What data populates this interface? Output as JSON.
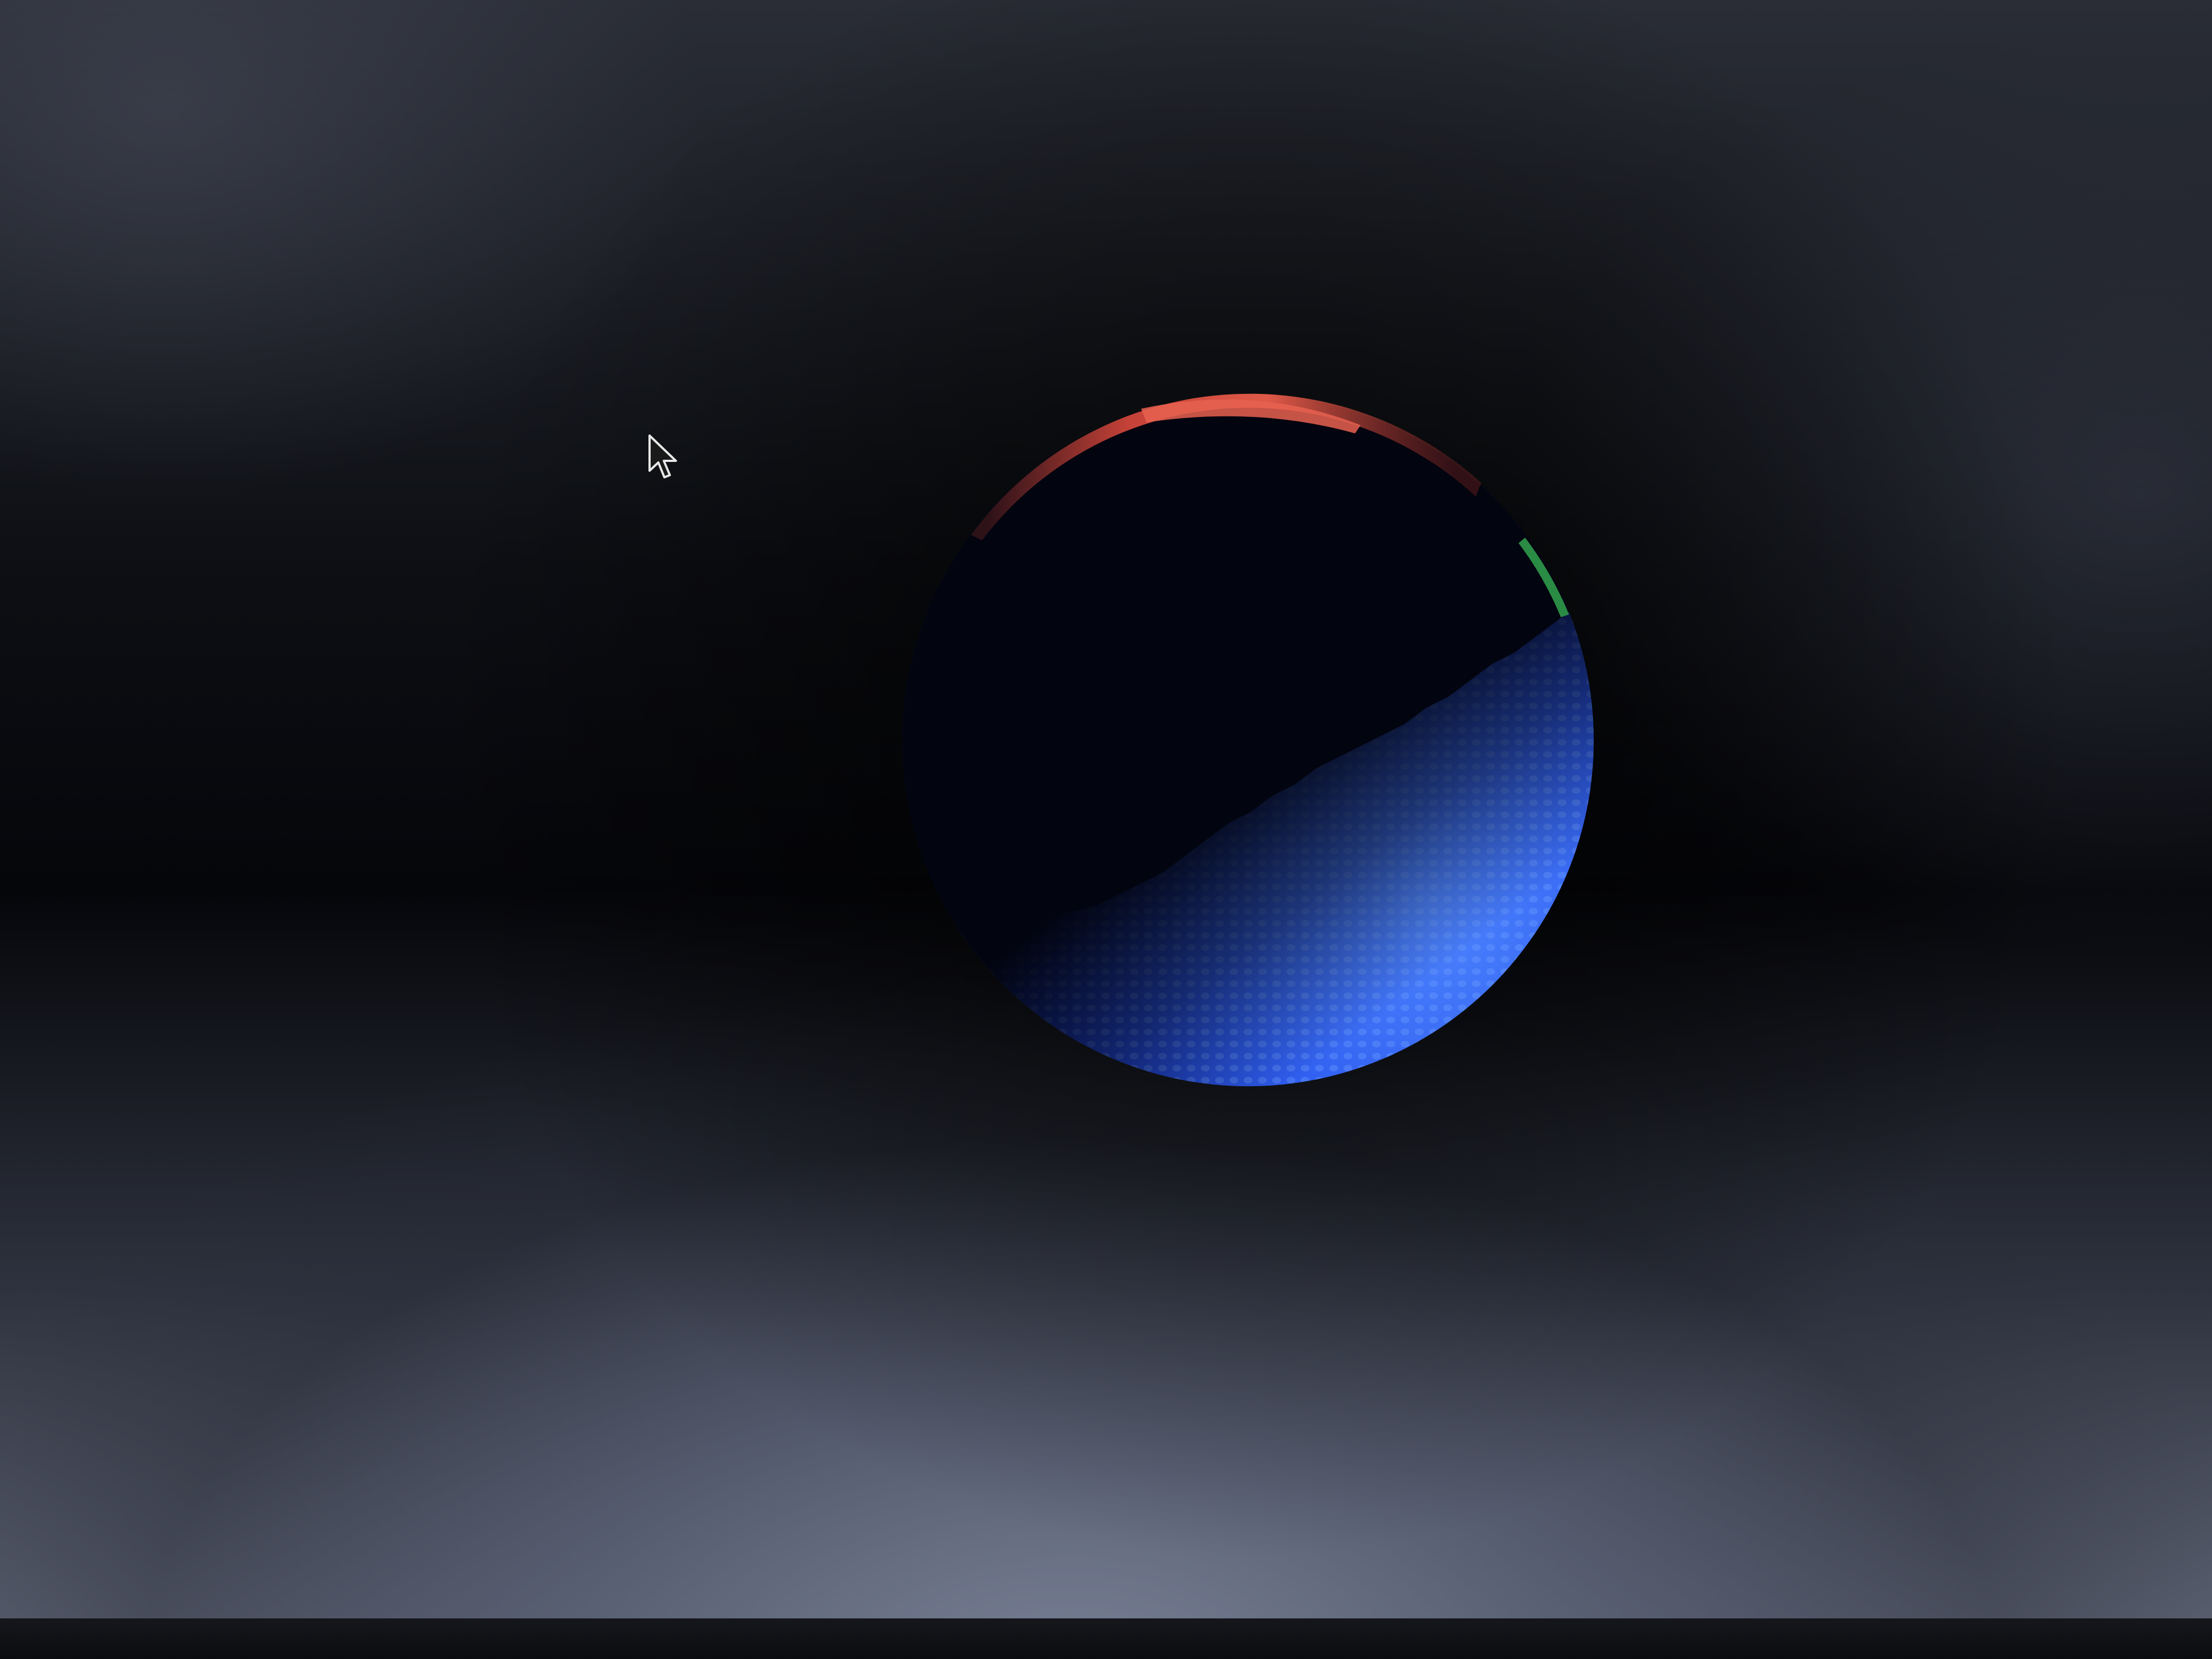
{
  "scene": {
    "object": "shaded-sphere",
    "colors": {
      "background": "#05060a",
      "sphere_lit": "#2f5ef0",
      "sphere_highlight": "#4f86ff",
      "sphere_dark": "#02040f",
      "rim_red": "#d9483c",
      "rim_green": "#2f9a4a",
      "bezel": "#0b0c0f"
    }
  },
  "cursor": {
    "icon": "arrow-cursor-icon"
  }
}
